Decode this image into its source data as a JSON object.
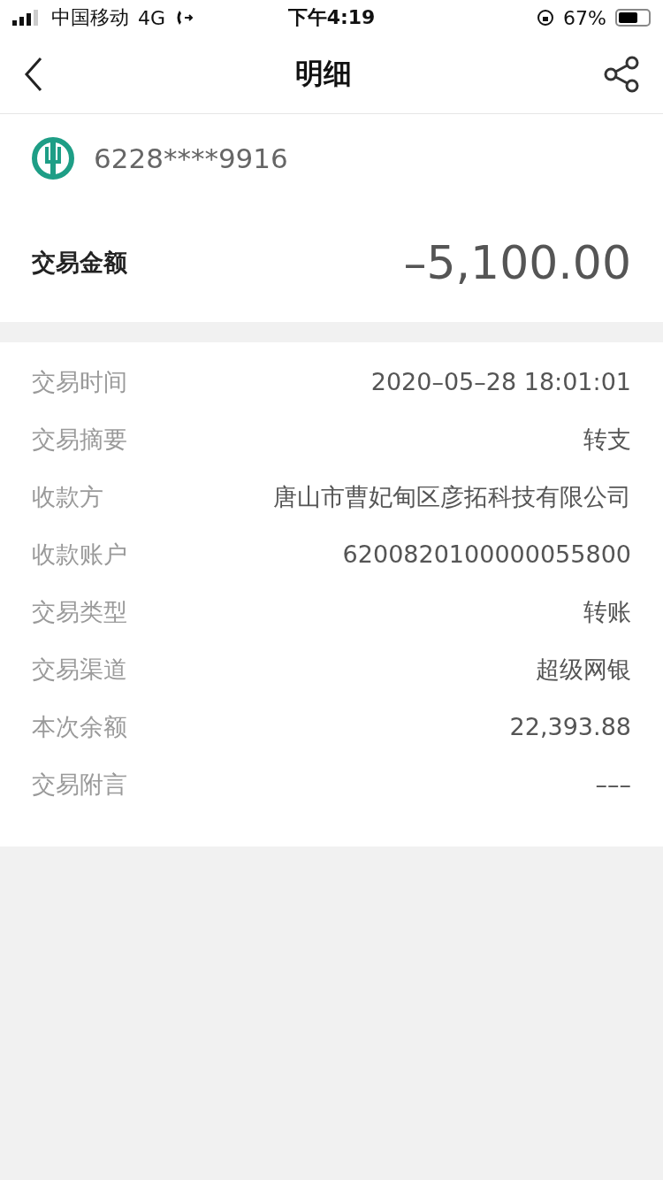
{
  "status_bar": {
    "carrier": "中国移动",
    "network": "4G",
    "time": "下午4:19",
    "battery": "67%"
  },
  "nav": {
    "title": "明细"
  },
  "account": {
    "number": "6228****9916"
  },
  "amount": {
    "label": "交易金额",
    "value": "–5,100.00"
  },
  "details": [
    {
      "label": "交易时间",
      "value": "2020–05–28 18:01:01"
    },
    {
      "label": "交易摘要",
      "value": "转支"
    },
    {
      "label": "收款方",
      "value": "唐山市曹妃甸区彦拓科技有限公司"
    },
    {
      "label": "收款账户",
      "value": "6200820100000055800"
    },
    {
      "label": "交易类型",
      "value": "转账"
    },
    {
      "label": "交易渠道",
      "value": "超级网银"
    },
    {
      "label": "本次余额",
      "value": "22,393.88"
    },
    {
      "label": "交易附言",
      "value": "–––"
    }
  ]
}
